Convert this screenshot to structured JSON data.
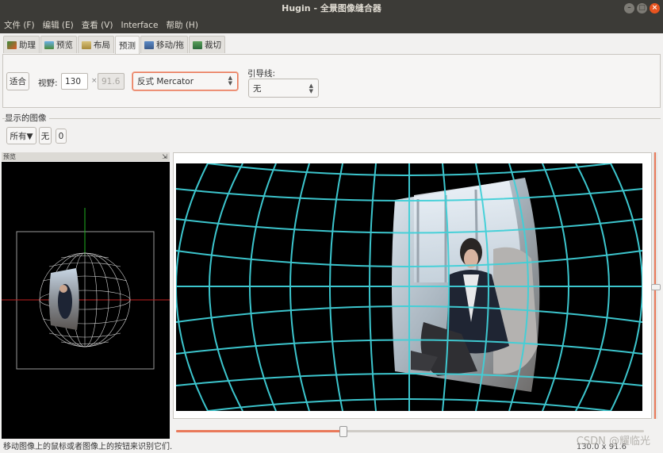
{
  "window": {
    "title": "Hugin - 全景图像缝合器"
  },
  "menu": [
    "文件 (F)",
    "编辑 (E)",
    "查看 (V)",
    "Interface",
    "帮助 (H)"
  ],
  "tabs": [
    {
      "label": "助理",
      "icon": "assistant-icon"
    },
    {
      "label": "预览",
      "icon": "preview-icon"
    },
    {
      "label": "布局",
      "icon": "layout-icon"
    },
    {
      "label": "预测",
      "icon": "",
      "active": true
    },
    {
      "label": "移动/拖",
      "icon": "move-drag-icon"
    },
    {
      "label": "裁切",
      "icon": "crop-icon"
    }
  ],
  "toolbar": {
    "fit_label": "适合",
    "fov_label": "视野:",
    "fov_h": "130",
    "times": "×",
    "fov_v": "91.6",
    "projection": "反式 Mercator",
    "guides_label": "引导线:",
    "guides_value": "无"
  },
  "images_group": {
    "title": "显示的图像",
    "all_label": "所有▼",
    "none_label": "无",
    "image_0": "0"
  },
  "dock": {
    "title": "预览",
    "pin": "⇲"
  },
  "status": {
    "left": "移动图像上的鼠标或者图像上的按钮来识别它们.",
    "right": "130.0 x 91.6"
  },
  "watermark": "CSDN @耀临光",
  "colors": {
    "accent": "#e9795a",
    "grid": "#40d0d8",
    "titlebar": "#3c3b37"
  }
}
